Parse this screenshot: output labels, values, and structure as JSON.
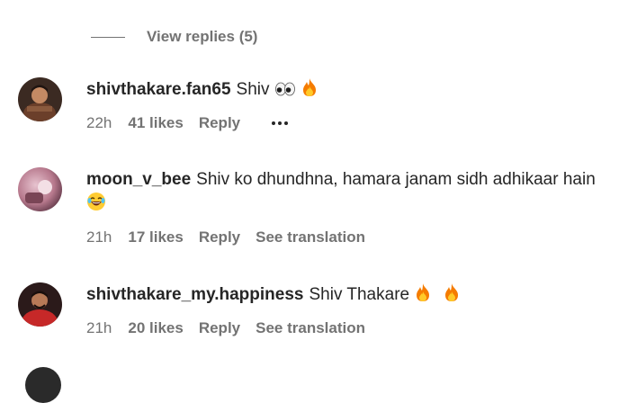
{
  "view_replies": {
    "label": "View replies (5)"
  },
  "comments": [
    {
      "username": "shivthakare.fan65",
      "text": "Shiv",
      "emojis": [
        "eyes",
        "fire"
      ],
      "time": "22h",
      "likes": "41 likes",
      "reply": "Reply",
      "show_more": true
    },
    {
      "username": "moon_v_bee",
      "text": "Shiv ko dhundhna, hamara janam sidh adhikaar hain",
      "emojis": [
        "laughing"
      ],
      "time": "21h",
      "likes": "17 likes",
      "reply": "Reply",
      "translation": "See translation"
    },
    {
      "username": "shivthakare_my.happiness",
      "text": "Shiv Thakare",
      "emojis": [
        "fire",
        "fire"
      ],
      "time": "21h",
      "likes": "20 likes",
      "reply": "Reply",
      "translation": "See translation"
    }
  ],
  "colors": {
    "text": "#262626",
    "secondary": "#737373",
    "background": "#ffffff"
  }
}
